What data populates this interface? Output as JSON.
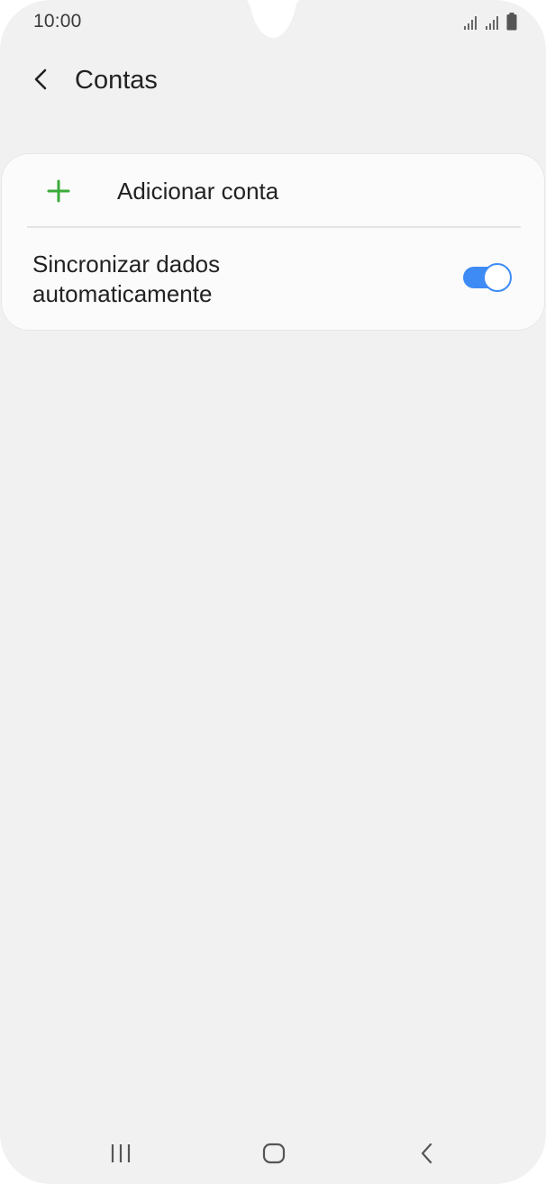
{
  "status_bar": {
    "time": "10:00"
  },
  "header": {
    "title": "Contas",
    "back_icon": "chevron-left-icon"
  },
  "accounts": {
    "add_account_label": "Adicionar conta",
    "add_icon": "plus-icon",
    "sync_label": "Sincronizar dados automaticamente",
    "sync_enabled": true
  },
  "nav_bar": {
    "recents_icon": "recents-icon",
    "home_icon": "home-icon",
    "back_icon": "back-icon"
  },
  "colors": {
    "background": "#f1f1f1",
    "card": "#fbfbfb",
    "accent": "#3e8bf5",
    "plus": "#3aab3a"
  }
}
